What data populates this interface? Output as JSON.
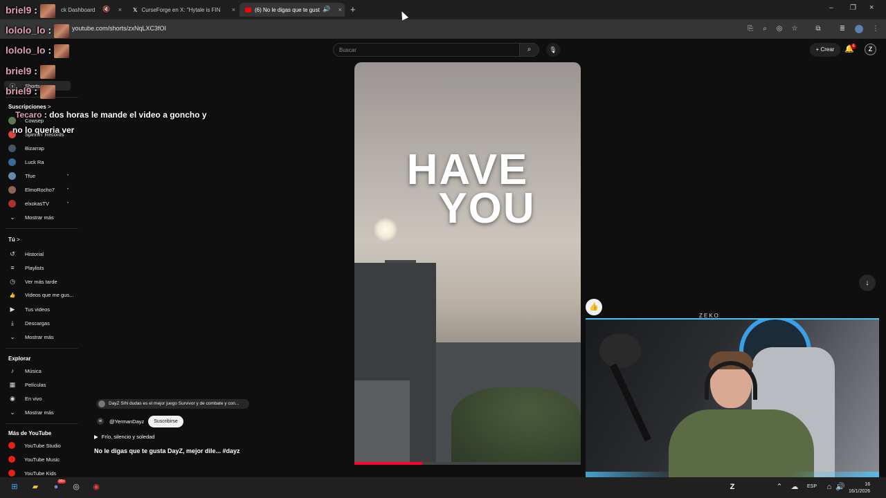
{
  "browser": {
    "tabs": [
      {
        "label": "ck Dashboard",
        "icon": "dashboard-tab-icon"
      },
      {
        "label": "CurseForge en X: \"Hytale is FIN",
        "icon": "x-logo-icon"
      },
      {
        "label": "(6) No le digas que te gust",
        "icon": "youtube-tab-icon"
      }
    ],
    "new_tab": "+",
    "url": "youtube.com/shorts/zxNqLXC3fOI"
  },
  "chat": [
    {
      "nick": "briel9",
      "sep": " :",
      "text": ""
    },
    {
      "nick": "lololo_lo",
      "sep": " :",
      "text": ""
    },
    {
      "nick": "lololo_lo",
      "sep": " :",
      "text": ""
    },
    {
      "nick": "briel9",
      "sep": " :",
      "text": ""
    },
    {
      "nick": "briel9",
      "sep": " :",
      "text": ""
    },
    {
      "nick": "Tecaro",
      "sep": " :",
      "text": " dos horas le mande el video a goncho y",
      "text2": "no lo queria ver"
    }
  ],
  "youtube": {
    "search_placeholder": "Buscar",
    "create_label": "Crear",
    "bell_badge": "6",
    "avatar_letter": "Z",
    "sidebar": {
      "shorts": "Shorts",
      "subscriptions_heading": "Suscripciones",
      "subscriptions_arrow": ">",
      "subs": [
        {
          "name": "Cowsep",
          "color": "#5c7a5a",
          "dot": ""
        },
        {
          "name": "Spinnin' Records",
          "color": "#d44",
          "dot": ""
        },
        {
          "name": "Bizarrap",
          "color": "#445566",
          "dot": ""
        },
        {
          "name": "Luck Ra",
          "color": "#3a6a9a",
          "dot": ""
        },
        {
          "name": "Tfue",
          "color": "#6a88aa",
          "dot": "•"
        },
        {
          "name": "ElmoRocho7",
          "color": "#886655",
          "dot": "•"
        },
        {
          "name": "elxokasTV",
          "color": "#b03030",
          "dot": "•"
        }
      ],
      "show_more": "Mostrar más",
      "you_heading": "Tú",
      "you_arrow": ">",
      "you_items": [
        {
          "label": "Historial",
          "icon": "history-icon",
          "glyph": "↺"
        },
        {
          "label": "Playlists",
          "icon": "playlist-icon",
          "glyph": "≡"
        },
        {
          "label": "Ver más tarde",
          "icon": "watch-later-icon",
          "glyph": "◷"
        },
        {
          "label": "Videos que me gus...",
          "icon": "liked-videos-icon",
          "glyph": "👍"
        },
        {
          "label": "Tus videos",
          "icon": "your-videos-icon",
          "glyph": "▶"
        },
        {
          "label": "Descargas",
          "icon": "downloads-icon",
          "glyph": "⤓"
        },
        {
          "label": "Mostrar más",
          "icon": "chevron-down-icon",
          "glyph": "⌄"
        }
      ],
      "explore_heading": "Explorar",
      "explore_items": [
        {
          "label": "Música",
          "icon": "music-icon",
          "glyph": "♪"
        },
        {
          "label": "Películas",
          "icon": "movies-icon",
          "glyph": "▦"
        },
        {
          "label": "En vivo",
          "icon": "live-icon",
          "glyph": "◉"
        },
        {
          "label": "Mostrar más",
          "icon": "chevron-down-icon",
          "glyph": "⌄"
        }
      ],
      "more_heading": "Más de YouTube",
      "more_items": [
        {
          "label": "YouTube Studio",
          "icon": "youtube-studio-icon"
        },
        {
          "label": "YouTube Music",
          "icon": "youtube-music-icon"
        },
        {
          "label": "YouTube Kids",
          "icon": "youtube-kids-icon"
        }
      ]
    },
    "short": {
      "headline_1": "HAVE",
      "headline_2": "YOU",
      "progress": 0.3,
      "description": "DayZ SIN dudas es el mejor juego Survivor y de combate y con...",
      "channel": "@YermanDayz",
      "subscribe": "Suscribirse",
      "song": "Frío, silencio y soledad",
      "title": "No le digas que te gusta DayZ, mejor dile... #dayz"
    }
  },
  "webcam": {
    "label": "ZEKO"
  },
  "taskbar": {
    "lang": "ESP",
    "time": "16",
    "date": "16/1/2026",
    "discord_badge": "99+"
  }
}
